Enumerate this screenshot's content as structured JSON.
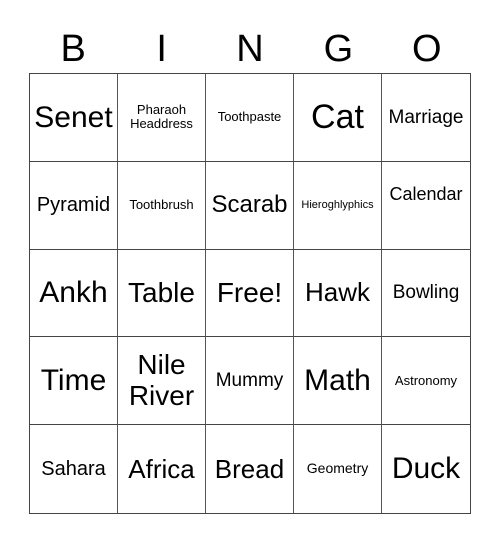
{
  "header": {
    "letters": [
      "B",
      "I",
      "N",
      "G",
      "O"
    ]
  },
  "cells": [
    [
      "Senet",
      "Pharaoh Headdress",
      "Toothpaste",
      "Cat",
      "Marriage"
    ],
    [
      "Pyramid",
      "Toothbrush",
      "Scarab",
      "Hieroghlyphics",
      "Calendar"
    ],
    [
      "Ankh",
      "Table",
      "Free!",
      "Hawk",
      "Bowling"
    ],
    [
      "Time",
      "Nile River",
      "Mummy",
      "Math",
      "Astronomy"
    ],
    [
      "Sahara",
      "Africa",
      "Bread",
      "Geometry",
      "Duck"
    ]
  ]
}
